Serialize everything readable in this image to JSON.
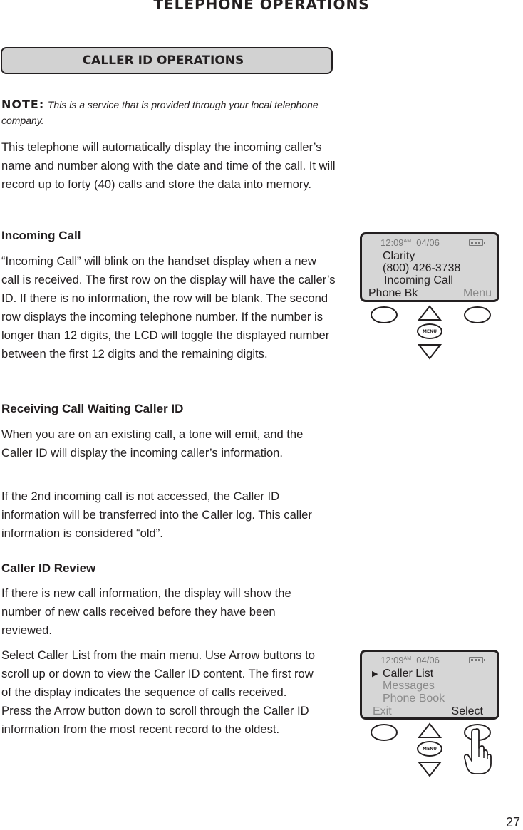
{
  "page": {
    "title": "TELEPHONE OPERATIONS",
    "section": "CALLER ID OPERATIONS",
    "page_number": "27"
  },
  "note": {
    "label": "NOTE:",
    "text": "This is a service that is provided through your local telephone company."
  },
  "intro": "This telephone will automatically display the incoming caller’s name and number along with the date and time of the call. It will record up to forty (40) calls and store the data into memory.",
  "incoming_call": {
    "heading": "Incoming Call",
    "body": "“Incoming Call” will blink on the handset display when a new call is received. The first row on the display will have the caller’s ID. If there is no information, the row will be blank. The second row displays the incoming telephone number. If the number is longer than 12 digits, the LCD will toggle the displayed number between the first 12 digits and the remaining digits."
  },
  "call_waiting": {
    "heading": "Receiving Call Waiting Caller ID",
    "body1": "When you are on an existing call, a tone will emit, and the Caller ID will display the incoming caller’s information.",
    "body2": "If the 2nd incoming call is not accessed, the Caller ID information will be transferred into the Caller log. This caller information is considered “old”."
  },
  "review": {
    "heading": "Caller ID Review",
    "body1": "If there is new call information, the display will show the number of new calls received before they have been reviewed.",
    "body2": "Select Caller List from the main menu. Use Arrow buttons to scroll up or down to view the Caller ID content. The first row of the display indicates the sequence of calls received. Press the Arrow button down to scroll through the Caller ID information from the most recent record to the oldest."
  },
  "display1": {
    "time": "12:09",
    "ampm": "AM",
    "date": "04/06",
    "line1": "Clarity",
    "line2": "(800) 426-3738",
    "line3": "Incoming Call",
    "softkey_left": "Phone Bk",
    "softkey_right": "Menu",
    "menu_button": "MENU"
  },
  "display2": {
    "time": "12:09",
    "ampm": "AM",
    "date": "04/06",
    "line1": "Caller List",
    "line2": "Messages",
    "line3": "Phone Book",
    "softkey_left": "Exit",
    "softkey_right": "Select",
    "menu_button": "MENU"
  }
}
